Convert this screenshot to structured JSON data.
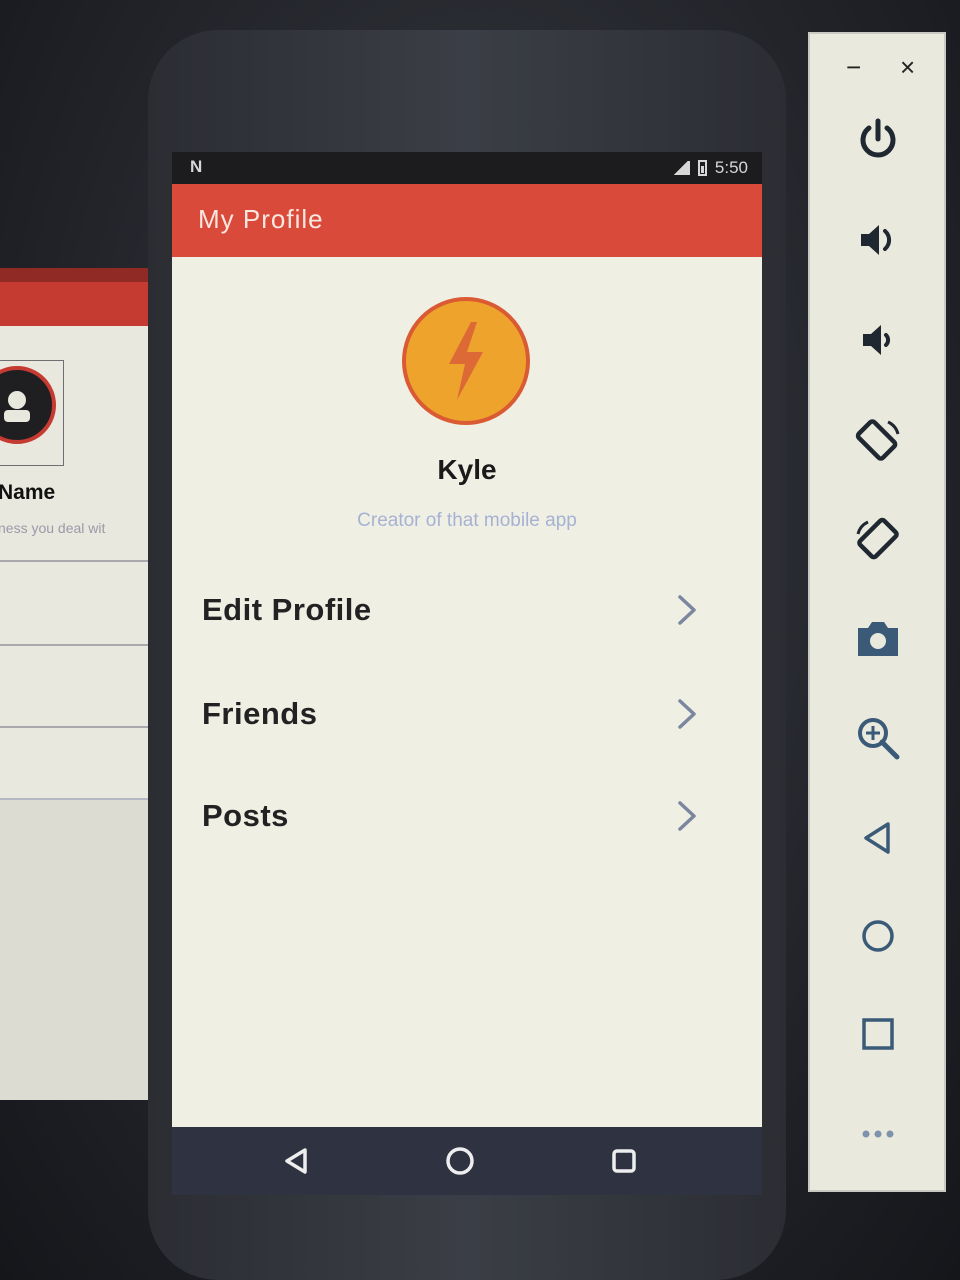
{
  "background_window": {
    "field_label": "Name",
    "field_hint": "ness you deal wit"
  },
  "status_bar": {
    "notification": "N",
    "time": "5:50"
  },
  "app_bar": {
    "title": "My Profile"
  },
  "profile": {
    "name": "Kyle",
    "bio": "Creator of that mobile app",
    "avatar_icon": "lightning-bolt-icon"
  },
  "menu": [
    {
      "label": "Edit Profile"
    },
    {
      "label": "Friends"
    },
    {
      "label": "Posts"
    }
  ],
  "colors": {
    "accent": "#d94a3a",
    "avatar_fill": "#eea32c",
    "avatar_border": "#d95a33",
    "bio_text": "#a6b2d3",
    "nav_bar": "#2f3240"
  },
  "emulator_toolbar": {
    "minimize": "−",
    "close": "×",
    "buttons": [
      "power-icon",
      "volume-up-icon",
      "volume-down-icon",
      "rotate-left-icon",
      "rotate-right-icon",
      "camera-icon",
      "zoom-icon",
      "back-icon",
      "home-icon",
      "overview-icon",
      "more-icon"
    ]
  }
}
